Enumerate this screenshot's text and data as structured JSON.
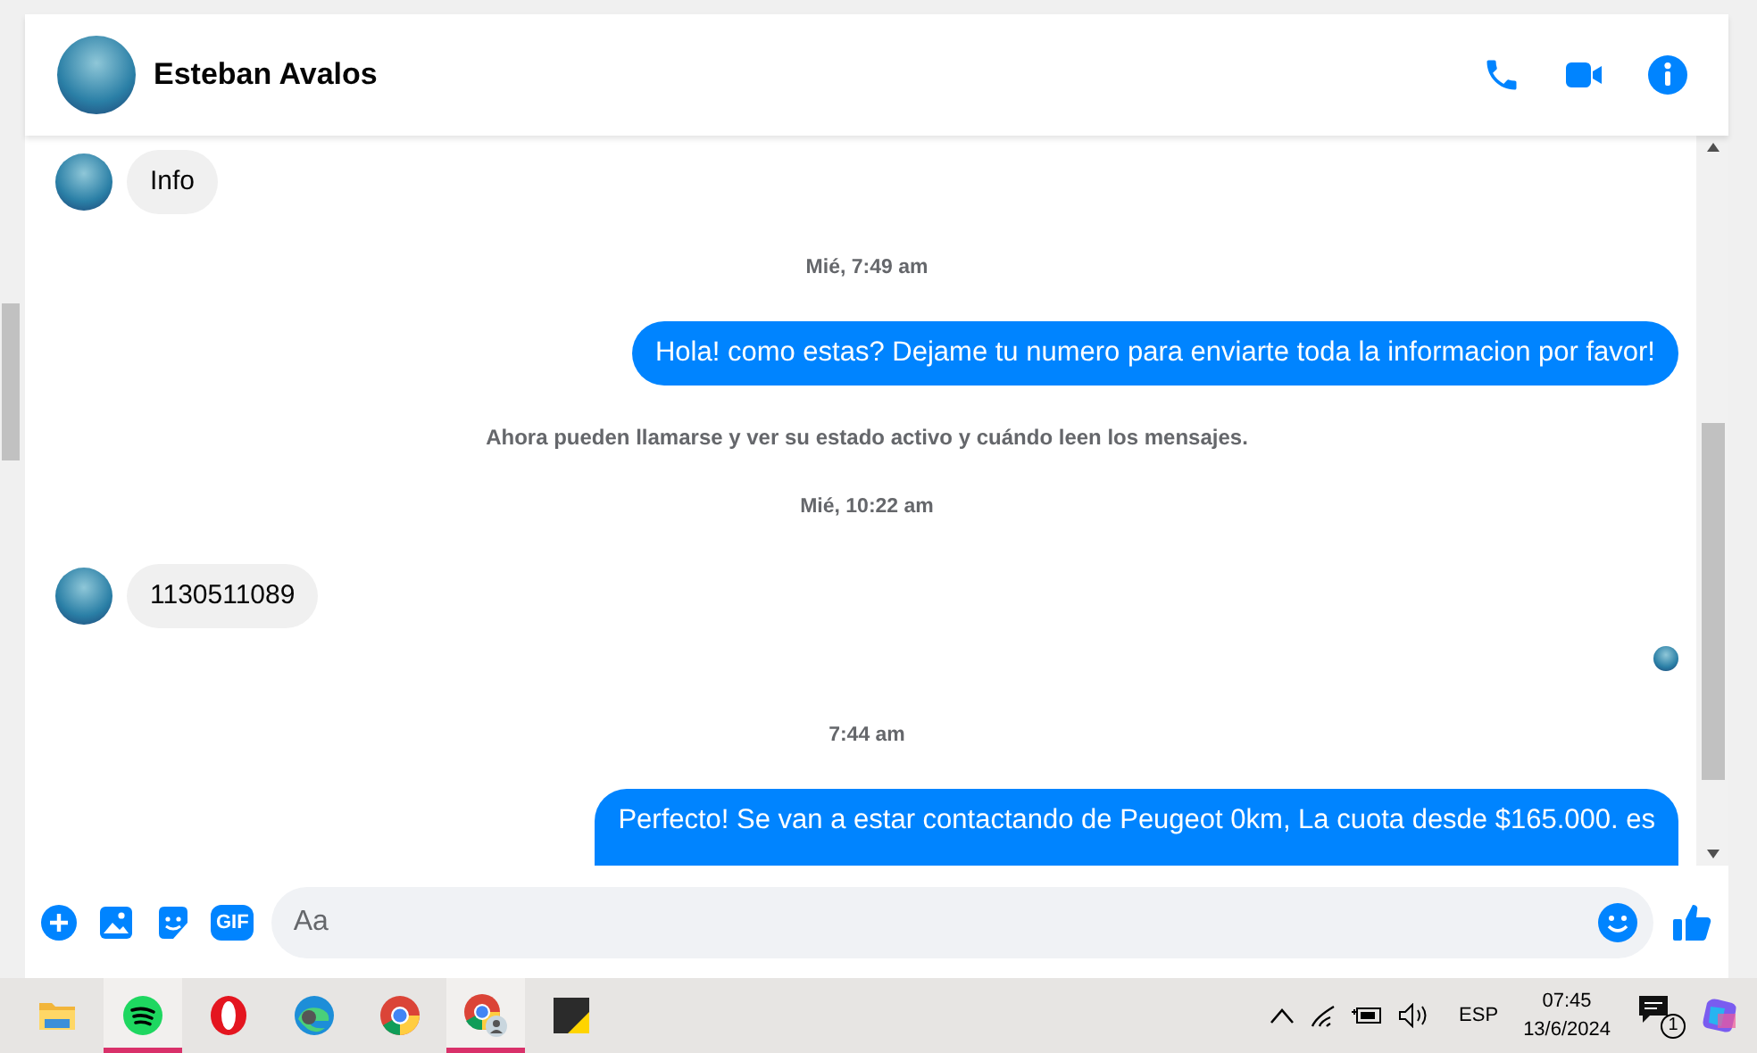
{
  "chat_header": {
    "contact_name": "Esteban Avalos"
  },
  "messages": [
    {
      "kind": "incoming",
      "text": "Info"
    },
    {
      "kind": "timestamp",
      "text": "Mié, 7:49 am"
    },
    {
      "kind": "outgoing",
      "text": "Hola! como estas? Dejame tu numero para enviarte toda la informacion por favor!"
    },
    {
      "kind": "notice",
      "text": "Ahora pueden llamarse y ver su estado activo y cuándo leen los mensajes."
    },
    {
      "kind": "timestamp",
      "text": "Mié, 10:22 am"
    },
    {
      "kind": "incoming",
      "text": "1130511089"
    },
    {
      "kind": "seen"
    },
    {
      "kind": "timestamp",
      "text": "7:44 am"
    },
    {
      "kind": "outgoing",
      "text": "Perfecto!  Se van a estar contactando de Peugeot 0km, La cuota desde $165.000. es"
    }
  ],
  "composer": {
    "gif_label": "GIF",
    "placeholder": "Aa"
  },
  "taskbar": {
    "apps": [
      {
        "kind": "folder",
        "running": false
      },
      {
        "kind": "spotify",
        "running": true
      },
      {
        "kind": "opera",
        "running": false
      },
      {
        "kind": "edge",
        "running": false
      },
      {
        "kind": "chrome",
        "running": false
      },
      {
        "kind": "chrome-profile",
        "running": true
      },
      {
        "kind": "notes",
        "running": false
      }
    ],
    "language": "ESP",
    "time": "07:45",
    "date": "13/6/2024",
    "notification_count": "1"
  }
}
